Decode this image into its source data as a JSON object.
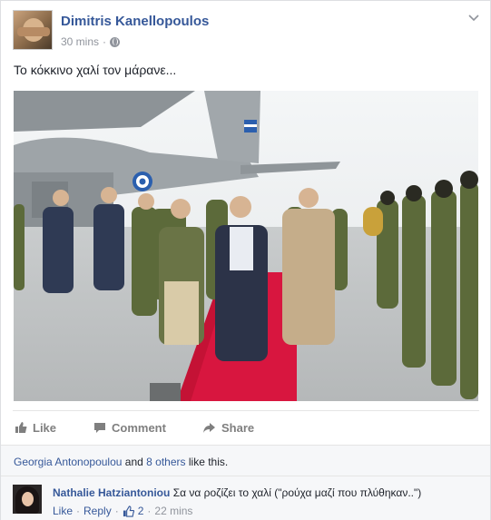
{
  "post": {
    "author": "Dimitris Kanellopoulos",
    "time": "30 mins",
    "separator": "·",
    "text": "Το κόκκινο χαλί τον μάρανε...",
    "chevron_icon": "chevron-down-icon",
    "privacy_icon": "globe-icon"
  },
  "actions": {
    "like": "Like",
    "comment": "Comment",
    "share": "Share"
  },
  "likes": {
    "first_liker": "Georgia Antonopoulou",
    "and": "and",
    "others": "8 others",
    "suffix": "like this."
  },
  "comment": {
    "author": "Nathalie Hatziantoniou",
    "text": "Σα να ροζίζει το χαλί (\"ρούχα μαζί που πλύθηκαν..\")",
    "like_label": "Like",
    "reply_label": "Reply",
    "like_count": "2",
    "time": "22 mins",
    "dot": "·"
  },
  "colors": {
    "link": "#365899",
    "muted": "#90949c",
    "carpet": "#d8163f"
  }
}
